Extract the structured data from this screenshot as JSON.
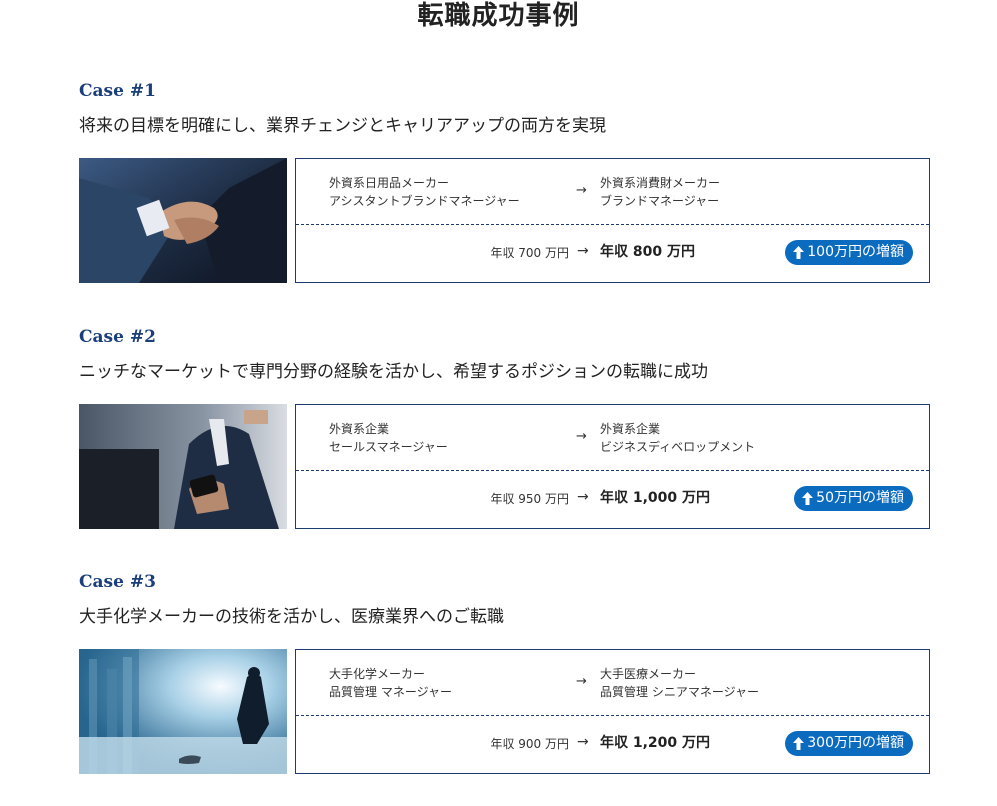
{
  "page": {
    "title": "転職成功事例"
  },
  "cases": [
    {
      "label": "Case #1",
      "headline": "将来の目標を明確にし、業界チェンジとキャリアアップの両方を実現",
      "from": {
        "company": "外資系日用品メーカー",
        "role": "アシスタントブランドマネージャー"
      },
      "to": {
        "company": "外資系消費財メーカー",
        "role": "ブランドマネージャー"
      },
      "arrow": "→",
      "salary_before": "年収 700 万円",
      "salary_after": "年収 800 万円",
      "increase": "100万円の増額",
      "photo_icon": "handshake-photo"
    },
    {
      "label": "Case #2",
      "headline": "ニッチなマーケットで専門分野の経験を活かし、希望するポジションの転職に成功",
      "from": {
        "company": "外資系企業",
        "role": "セールスマネージャー"
      },
      "to": {
        "company": "外資系企業",
        "role": "ビジネスディベロップメント"
      },
      "arrow": "→",
      "salary_before": "年収 950 万円",
      "salary_after": "年収 1,000 万円",
      "increase": "50万円の増額",
      "photo_icon": "businessman-phone-photo"
    },
    {
      "label": "Case #3",
      "headline": "大手化学メーカーの技術を活かし、医療業界へのご転職",
      "from": {
        "company": "大手化学メーカー",
        "role": "品質管理 マネージャー"
      },
      "to": {
        "company": "大手医療メーカー",
        "role": "品質管理 シニアマネージャー"
      },
      "arrow": "→",
      "salary_before": "年収 900 万円",
      "salary_after": "年収 1,200 万円",
      "increase": "300万円の増額",
      "photo_icon": "window-city-photo"
    }
  ],
  "colors": {
    "accent": "#1a3f7a",
    "badge": "#0b6bbf",
    "border": "#1d3b6e"
  }
}
